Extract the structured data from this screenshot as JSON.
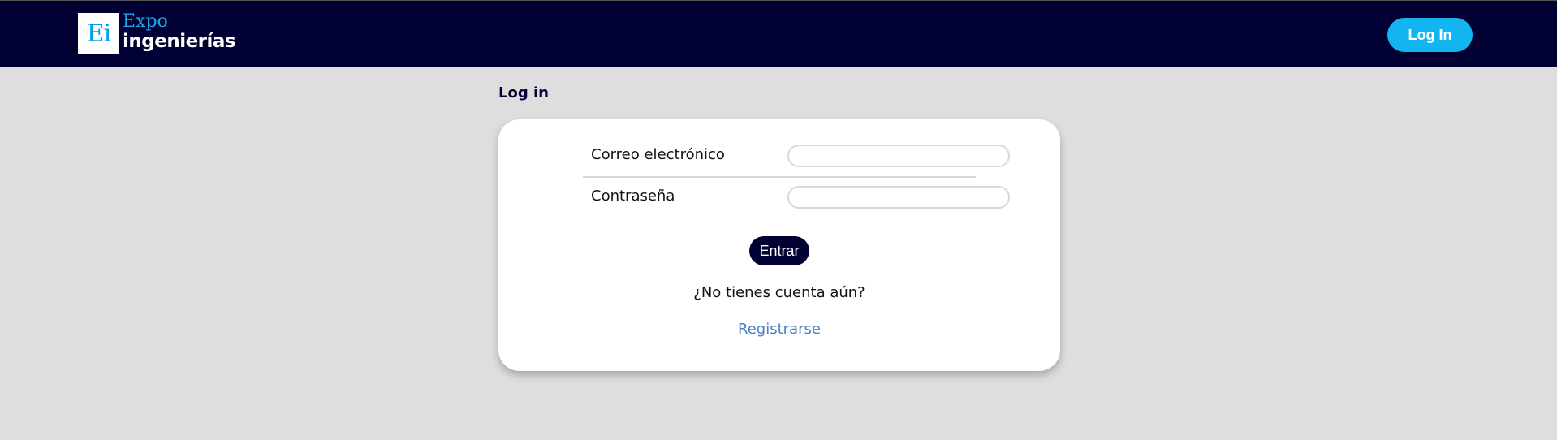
{
  "header": {
    "logo_mark": "Ei",
    "logo_line1": "Expo",
    "logo_line2": "ingenierías",
    "login_button": "Log In"
  },
  "page": {
    "title": "Log in"
  },
  "form": {
    "email_label": "Correo electrónico",
    "email_value": "",
    "password_label": "Contraseña",
    "password_value": "",
    "submit_label": "Entrar",
    "no_account_text": "¿No tienes cuenta aún?",
    "register_link": "Registrarse"
  },
  "colors": {
    "navbar": "#000033",
    "accent": "#12b5ef",
    "link": "#4a7fc4",
    "background": "#dedede"
  }
}
